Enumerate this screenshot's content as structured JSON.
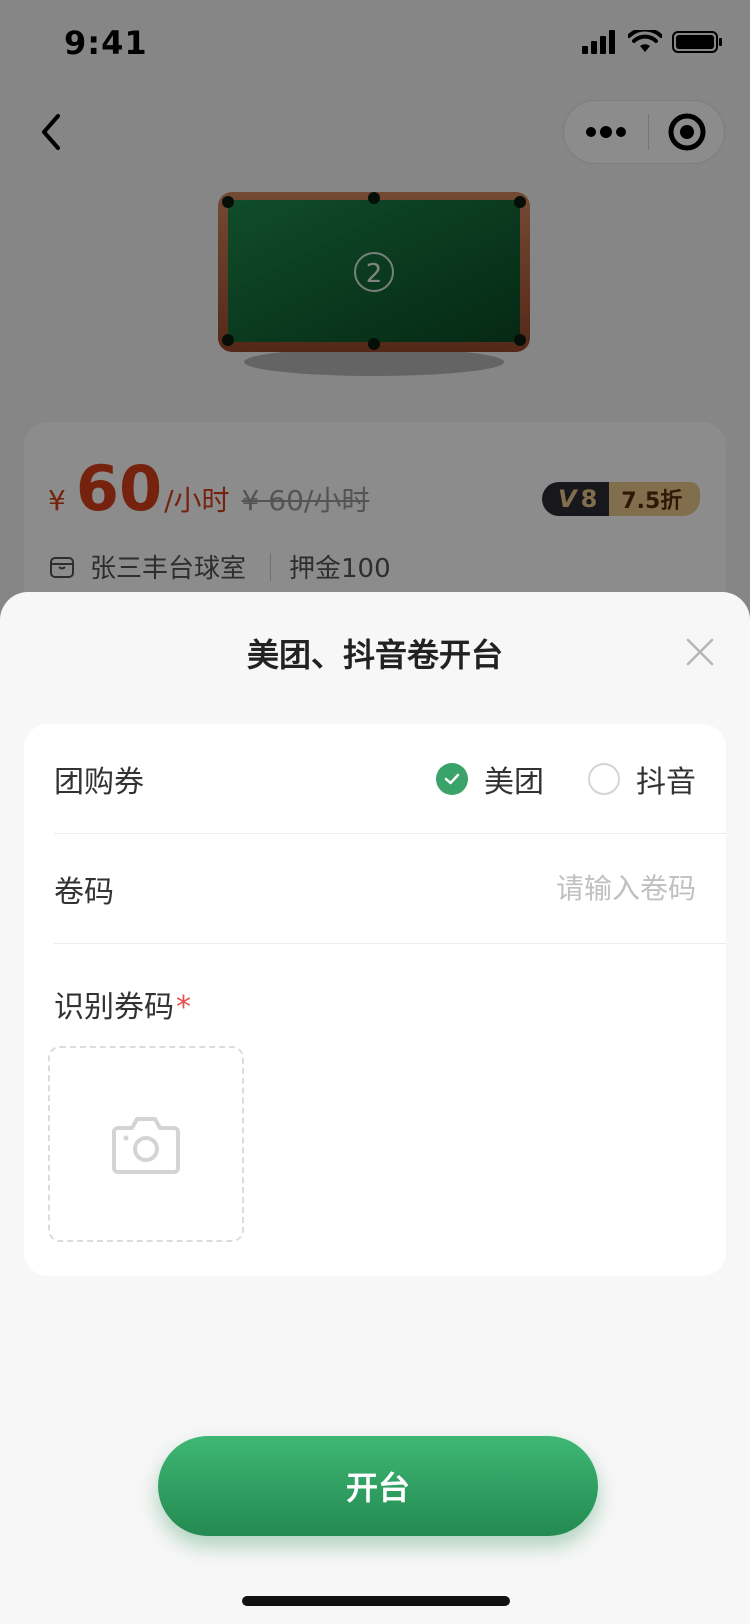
{
  "status_bar": {
    "time": "9:41"
  },
  "nav": {
    "back_icon": "chevron-left-icon",
    "more_icon": "more-dots-icon",
    "target_icon": "target-icon"
  },
  "table": {
    "number": "2"
  },
  "info": {
    "currency": "¥",
    "price": "60",
    "unit": "/小时",
    "original_price": "¥ 60/小时",
    "vip_level": "8",
    "vip_discount": "7.5折",
    "store_name": "张三丰台球室",
    "deposit": "押金100"
  },
  "sheet": {
    "title": "美团、抖音卷开台",
    "voucher_label": "团购券",
    "options": [
      {
        "label": "美团",
        "checked": true
      },
      {
        "label": "抖音",
        "checked": false
      }
    ],
    "code_label": "卷码",
    "code_placeholder": "请输入卷码",
    "code_value": "",
    "scan_label": "识别券码",
    "required_mark": "*",
    "submit_label": "开台"
  },
  "colors": {
    "accent": "#3aa36a",
    "price": "#d6401c",
    "button_top": "#3fb774",
    "button_bottom": "#238a51"
  }
}
